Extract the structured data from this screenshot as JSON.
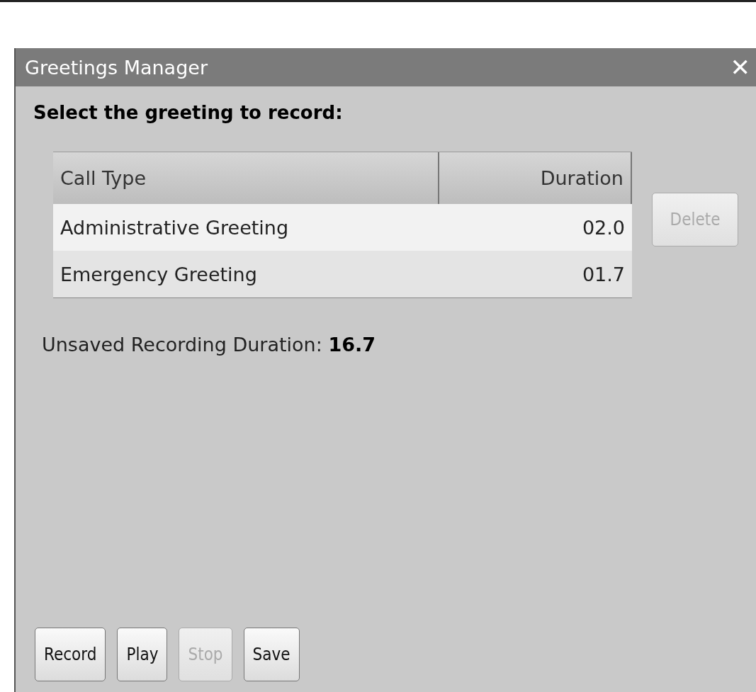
{
  "window": {
    "title": "Greetings Manager",
    "close": "✕"
  },
  "heading": "Select the greeting to record:",
  "table": {
    "columns": [
      "Call Type",
      "Duration"
    ],
    "rows": [
      {
        "cells": [
          "Administrative Greeting",
          "02.0"
        ]
      },
      {
        "cells": [
          "Emergency Greeting",
          "01.7"
        ]
      }
    ]
  },
  "side_button": {
    "label": "Delete",
    "disabled": true
  },
  "unsaved": {
    "label": "Unsaved Recording Duration:",
    "value": "16.7"
  },
  "buttons": [
    {
      "label": "Record",
      "disabled": false
    },
    {
      "label": "Play",
      "disabled": false
    },
    {
      "label": "Stop",
      "disabled": true
    },
    {
      "label": "Save",
      "disabled": false
    }
  ]
}
